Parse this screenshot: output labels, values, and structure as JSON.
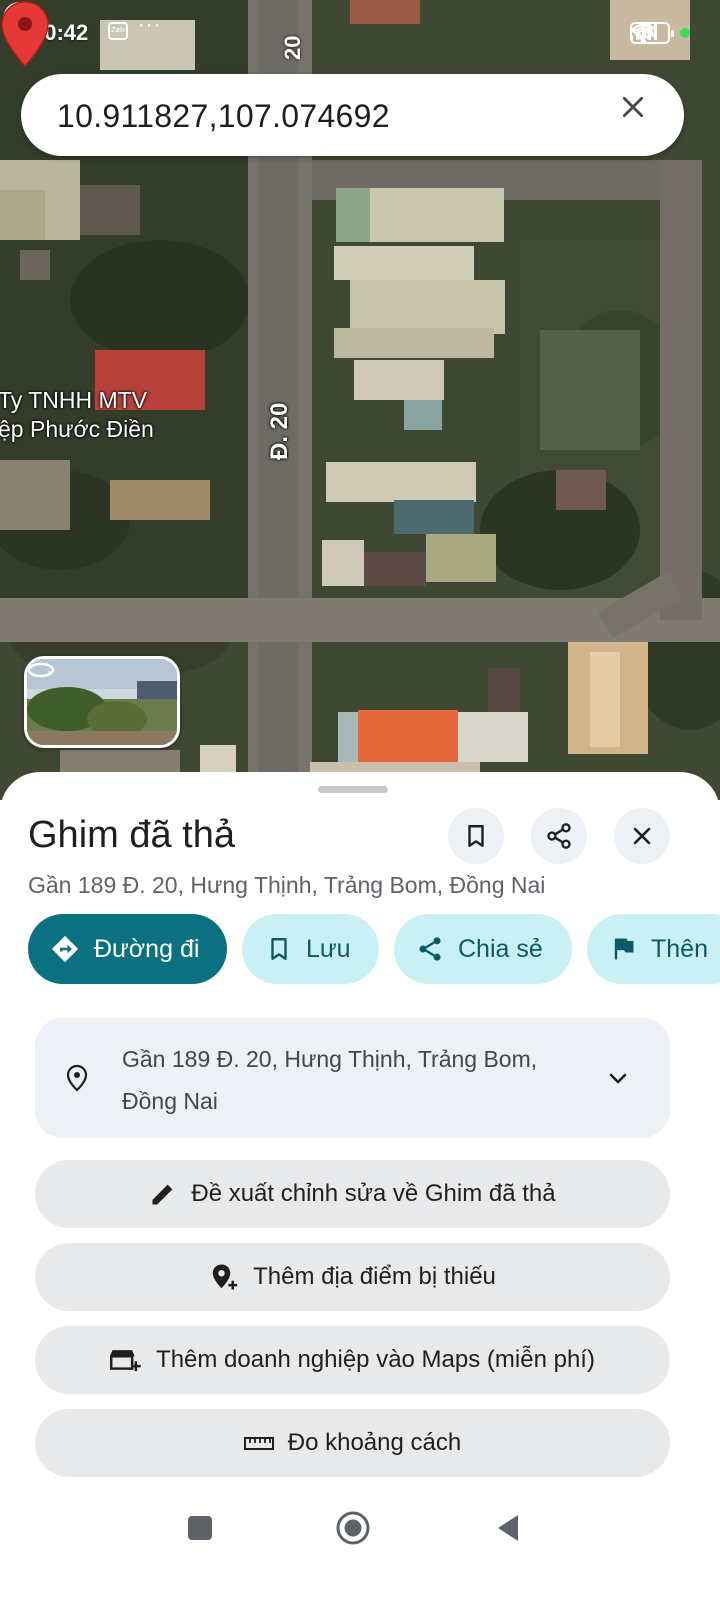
{
  "status_bar": {
    "time": "20:42",
    "zalo": "Zalo",
    "dots": "···",
    "battery": "39"
  },
  "search": {
    "value": "10.911827,107.074692"
  },
  "map": {
    "road_label_top": "20",
    "road_label": "Đ. 20",
    "poi_line1": "Ty TNHH MTV",
    "poi_line2": "ệp Phước Điền"
  },
  "place": {
    "title": "Ghim đã thả",
    "subtitle": "Gần 189 Đ. 20, Hưng Thịnh, Trảng Bom, Đồng Nai"
  },
  "chips": {
    "directions": "Đường đi",
    "save": "Lưu",
    "share": "Chia sẻ",
    "more": "Thên"
  },
  "address": {
    "line1": "Gần 189 Đ. 20, Hưng Thịnh, Trảng Bom,",
    "line2": "Đồng Nai"
  },
  "actions": {
    "suggest_edit": "Đề xuất chỉnh sửa về Ghim đã thả",
    "add_missing_place": "Thêm địa điểm bị thiếu",
    "add_business": "Thêm doanh nghiệp vào Maps (miễn phí)",
    "measure_distance": "Đo khoảng cách"
  },
  "colors": {
    "primary": "#0b7180",
    "chip_secondary": "#c9f1f5",
    "pin_red": "#e53935",
    "card_bg": "#edf0f4"
  },
  "icons": {
    "directions": "directions-icon",
    "bookmark": "bookmark-icon",
    "share": "share-icon",
    "flag": "flag-icon",
    "location_pin": "location-pin-icon",
    "pencil": "pencil-icon",
    "add_location": "add-location-icon",
    "add_business": "add-business-icon",
    "ruler": "ruler-icon"
  }
}
